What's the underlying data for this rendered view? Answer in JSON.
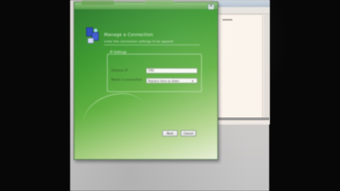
{
  "dialog": {
    "heading": "Manage a Connection",
    "subheading": "Enter the connection settings to be applied",
    "group_title": "IP Settings",
    "ip_label": "Address IP",
    "ip_value": "192",
    "connection_label": "Name a connection",
    "connection_value": "Replace here as down",
    "next_label": "Next",
    "cancel_label": "Cancel",
    "close_glyph": "×"
  },
  "icons": {
    "connector": "network-connector-icon",
    "close": "close-icon",
    "dropdown": "chevron-down-icon"
  },
  "colors": {
    "dialog_green": "#3b9a2e",
    "dialog_light": "#e8efd8"
  }
}
